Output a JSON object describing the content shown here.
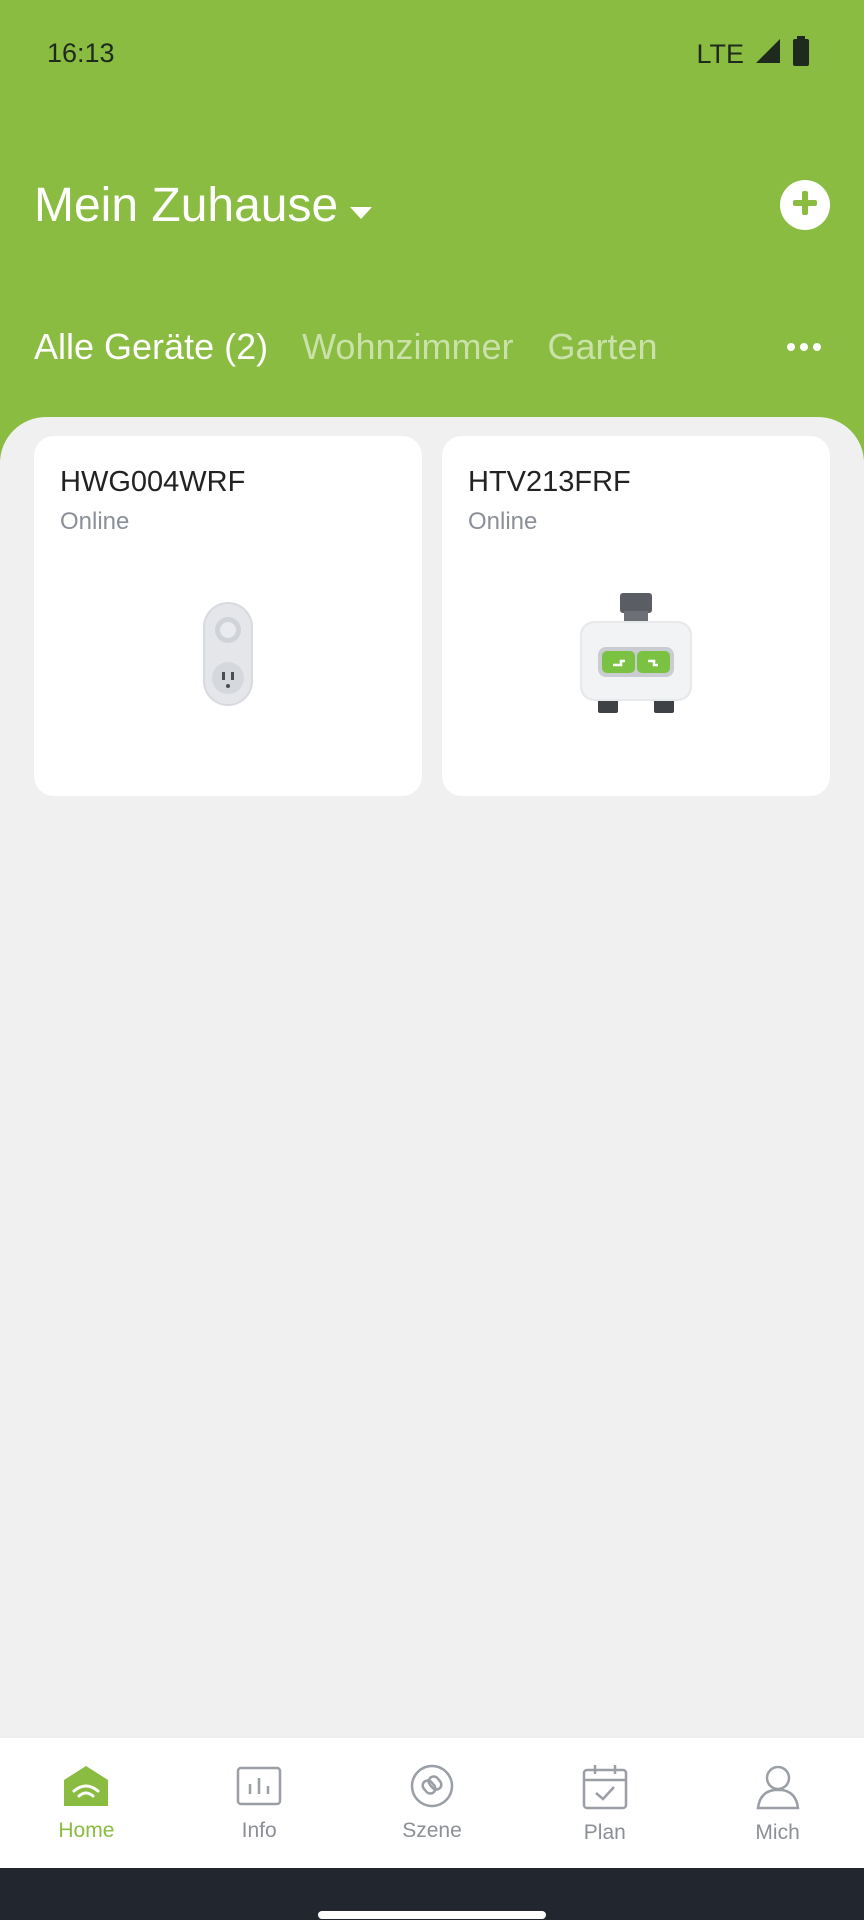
{
  "status_bar": {
    "time": "16:13",
    "network": "LTE"
  },
  "header": {
    "title": "Mein Zuhause"
  },
  "tabs": [
    {
      "label": "Alle Geräte (2)",
      "active": true
    },
    {
      "label": "Wohnzimmer",
      "active": false
    },
    {
      "label": "Garten",
      "active": false
    }
  ],
  "devices": [
    {
      "name": "HWG004WRF",
      "status": "Online",
      "icon": "smart-plug-icon"
    },
    {
      "name": "HTV213FRF",
      "status": "Online",
      "icon": "water-timer-icon"
    }
  ],
  "bottom_nav": [
    {
      "label": "Home",
      "icon": "home-icon",
      "active": true
    },
    {
      "label": "Info",
      "icon": "chart-icon",
      "active": false
    },
    {
      "label": "Szene",
      "icon": "scene-icon",
      "active": false
    },
    {
      "label": "Plan",
      "icon": "calendar-icon",
      "active": false
    },
    {
      "label": "Mich",
      "icon": "person-icon",
      "active": false
    }
  ],
  "colors": {
    "accent": "#89bc40",
    "background": "#f0f0f0",
    "inactive": "#8b8f96"
  }
}
